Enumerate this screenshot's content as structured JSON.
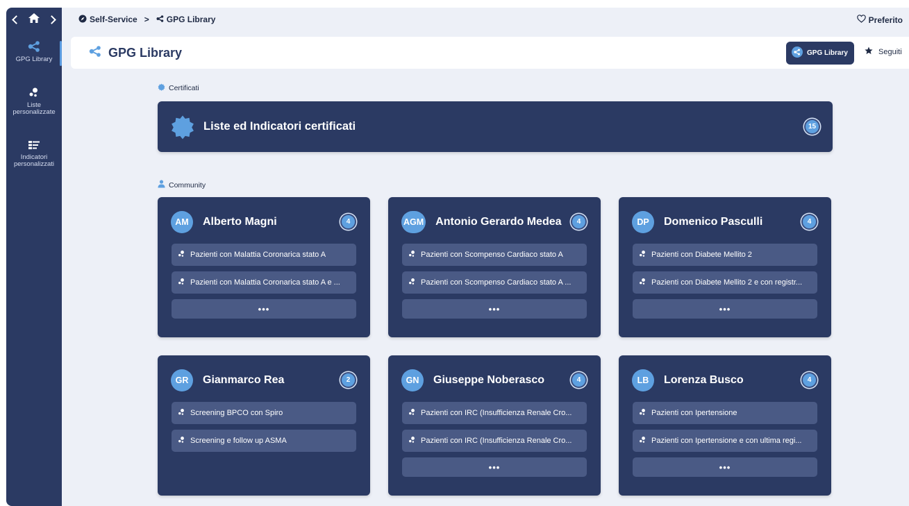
{
  "breadcrumb": {
    "root": "Self-Service",
    "current": "GPG Library"
  },
  "favorite_label": "Preferito",
  "rail": {
    "items": [
      {
        "label": "GPG Library"
      },
      {
        "label_line1": "Liste",
        "label_line2": "personalizzate"
      },
      {
        "label_line1": "Indicatori",
        "label_line2": "personalizzati"
      }
    ]
  },
  "header": {
    "title": "GPG Library",
    "library_button": "GPG Library",
    "followed_button": "Seguiti"
  },
  "certified": {
    "section_label": "Certificati",
    "banner_title": "Liste ed Indicatori certificati",
    "count": "15"
  },
  "community": {
    "section_label": "Community",
    "more_label": "•••",
    "cards": [
      {
        "initials": "AM",
        "name": "Alberto Magni",
        "count": "4",
        "items": [
          "Pazienti con Malattia Coronarica stato A",
          "Pazienti con Malattia Coronarica stato A e ..."
        ]
      },
      {
        "initials": "AGM",
        "name": "Antonio Gerardo Medea",
        "count": "4",
        "items": [
          "Pazienti con Scompenso Cardiaco stato A",
          "Pazienti con Scompenso Cardiaco stato A ..."
        ]
      },
      {
        "initials": "DP",
        "name": "Domenico Pasculli",
        "count": "4",
        "items": [
          "Pazienti con Diabete Mellito 2",
          "Pazienti con Diabete Mellito 2 e con registr..."
        ]
      },
      {
        "initials": "GR",
        "name": "Gianmarco Rea",
        "count": "2",
        "items": [
          "Screening BPCO con Spiro",
          "Screening e follow up ASMA"
        ]
      },
      {
        "initials": "GN",
        "name": "Giuseppe Noberasco",
        "count": "4",
        "items": [
          "Pazienti con IRC (Insufficienza Renale Cro...",
          "Pazienti con IRC (Insufficienza Renale Cro..."
        ]
      },
      {
        "initials": "LB",
        "name": "Lorenza Busco",
        "count": "4",
        "items": [
          "Pazienti con Ipertensione",
          "Pazienti con Ipertensione e con ultima regi..."
        ]
      }
    ]
  },
  "colors": {
    "primary": "#2b3a63",
    "accent": "#5ea0e0",
    "item_bg": "#4a5a85",
    "page_bg": "#edf0f7"
  }
}
